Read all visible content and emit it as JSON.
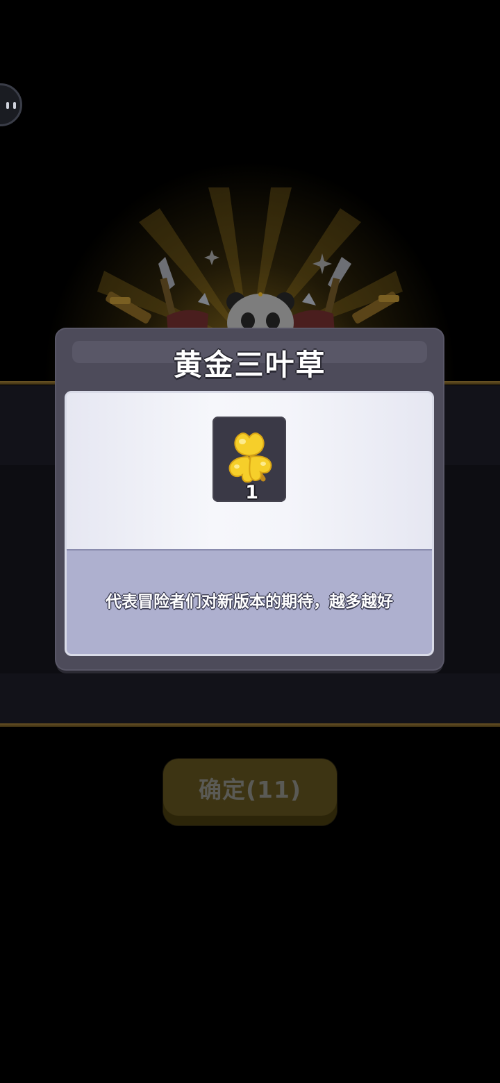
{
  "dialog": {
    "title": "黄金三叶草",
    "item": {
      "icon": "golden-clover-icon",
      "quantity": "1"
    },
    "description": "代表冒险者们对新版本的期待，越多越好"
  },
  "confirm_button": {
    "label": "确定(11)"
  },
  "colors": {
    "modal_bg": "#4d4b5a",
    "panel_bottom": "#aeb0cf",
    "clover": "#f6cf2a",
    "button_disabled": "#3d3413"
  }
}
